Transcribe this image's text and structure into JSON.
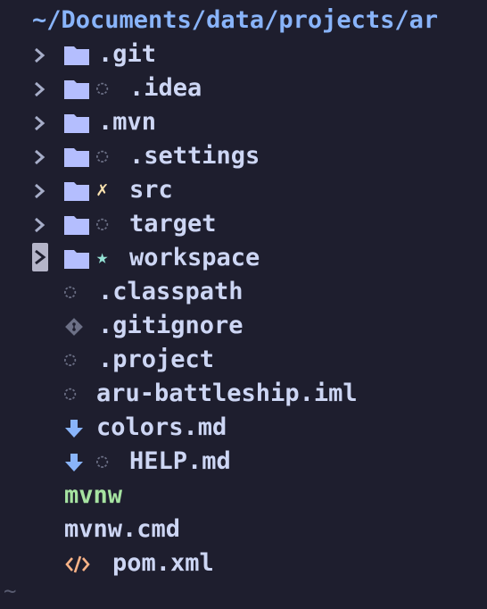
{
  "path": "~/Documents/data/projects/ar",
  "tree": {
    "items": [
      {
        "name": ".git"
      },
      {
        "name": ".idea",
        "badge": "◌"
      },
      {
        "name": ".mvn"
      },
      {
        "name": ".settings",
        "badge": "◌"
      },
      {
        "name": "src",
        "badge": "✗"
      },
      {
        "name": "target",
        "badge": "◌"
      },
      {
        "name": "workspace",
        "badge": "★"
      },
      {
        "name": ".classpath",
        "badge": "◌"
      },
      {
        "name": ".gitignore"
      },
      {
        "name": ".project",
        "badge": "◌"
      },
      {
        "name": "aru-battleship.iml",
        "badge": "◌"
      },
      {
        "name": "colors.md"
      },
      {
        "name": "HELP.md",
        "badge": "◌"
      },
      {
        "name": "mvnw"
      },
      {
        "name": "mvnw.cmd"
      },
      {
        "name": "pom.xml"
      }
    ]
  },
  "tilde": "~",
  "colors": {
    "background": "#1e1e2e",
    "path": "#89b4fa",
    "folder": "#b4befe",
    "text": "#cdd6f4",
    "untracked_badge": "#6c7086",
    "deleted_badge": "#f9e2af",
    "staged_badge": "#94e2d5",
    "executable": "#a6e3a1",
    "markdown_icon": "#89b4fa",
    "xml_icon": "#fab387",
    "git_icon": "#6c7086"
  }
}
